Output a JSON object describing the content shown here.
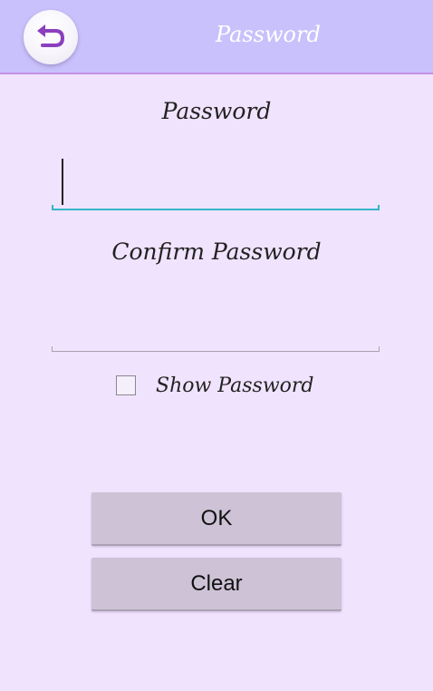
{
  "topbar": {
    "title": "Password",
    "back_icon": "undo-arrow-icon"
  },
  "form": {
    "password_label": "Password",
    "password_value": "",
    "confirm_label": "Confirm Password",
    "confirm_value": "",
    "show_password_label": "Show Password",
    "show_password_checked": false
  },
  "buttons": {
    "ok_label": "OK",
    "clear_label": "Clear"
  },
  "colors": {
    "background": "#f0e3fd",
    "topbar": "#c9c1fb",
    "topbar_border": "#c58fe6",
    "back_icon": "#8b3fbf",
    "focused_underline": "#33b5c8",
    "button": "#cdc2d6"
  }
}
